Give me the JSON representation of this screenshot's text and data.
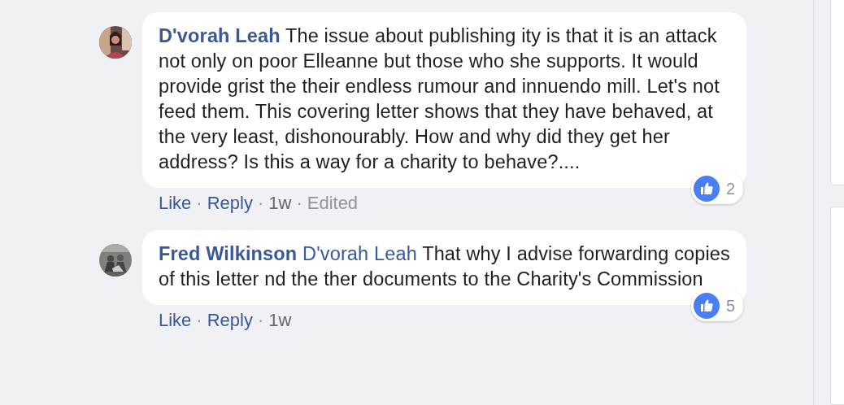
{
  "comments": [
    {
      "author": "D'vorah Leah",
      "text": "The issue about publishing ity is that it is an attack not only on poor Elleanne but those who she supports. It would provide grist the their endless rumour and innuendo mill. Let's not feed them. This covering letter shows that they have behaved, at the very least, dishonourably. How and why did they get her address? Is this a way for a charity to behave?....",
      "avatar": {
        "kind": "picture"
      },
      "reaction_count": "2",
      "separator": "·",
      "meta": [
        {
          "kind": "link",
          "text": "Like"
        },
        {
          "kind": "link",
          "text": "Reply"
        },
        {
          "kind": "time",
          "text": "1w"
        },
        {
          "kind": "edited",
          "text": "Edited"
        }
      ]
    },
    {
      "author": "Fred Wilkinson",
      "mention": "D'vorah Leah",
      "text": "That why I advise forwarding copies of this letter nd the ther documents to the Charity's Commission",
      "avatar": {
        "kind": "picture"
      },
      "reaction_count": "5",
      "separator": "·",
      "meta": [
        {
          "kind": "link",
          "text": "Like"
        },
        {
          "kind": "link",
          "text": "Reply"
        },
        {
          "kind": "time",
          "text": "1w"
        }
      ]
    }
  ]
}
